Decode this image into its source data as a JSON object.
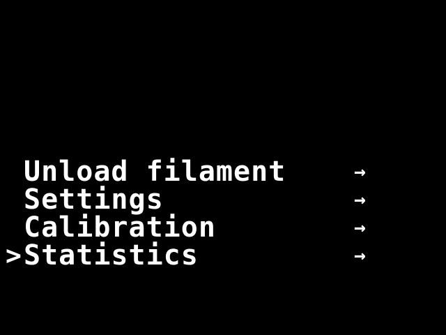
{
  "colors": {
    "background": "#000000",
    "text": "#ffffff"
  },
  "menu": {
    "items": [
      {
        "label": "Unload filament",
        "arrow": "→",
        "selected": false,
        "cursor": ""
      },
      {
        "label": "Settings",
        "arrow": "→",
        "selected": false,
        "cursor": ""
      },
      {
        "label": "Calibration",
        "arrow": "→",
        "selected": false,
        "cursor": ""
      },
      {
        "label": "Statistics",
        "arrow": "→",
        "selected": true,
        "cursor": ">"
      }
    ]
  }
}
